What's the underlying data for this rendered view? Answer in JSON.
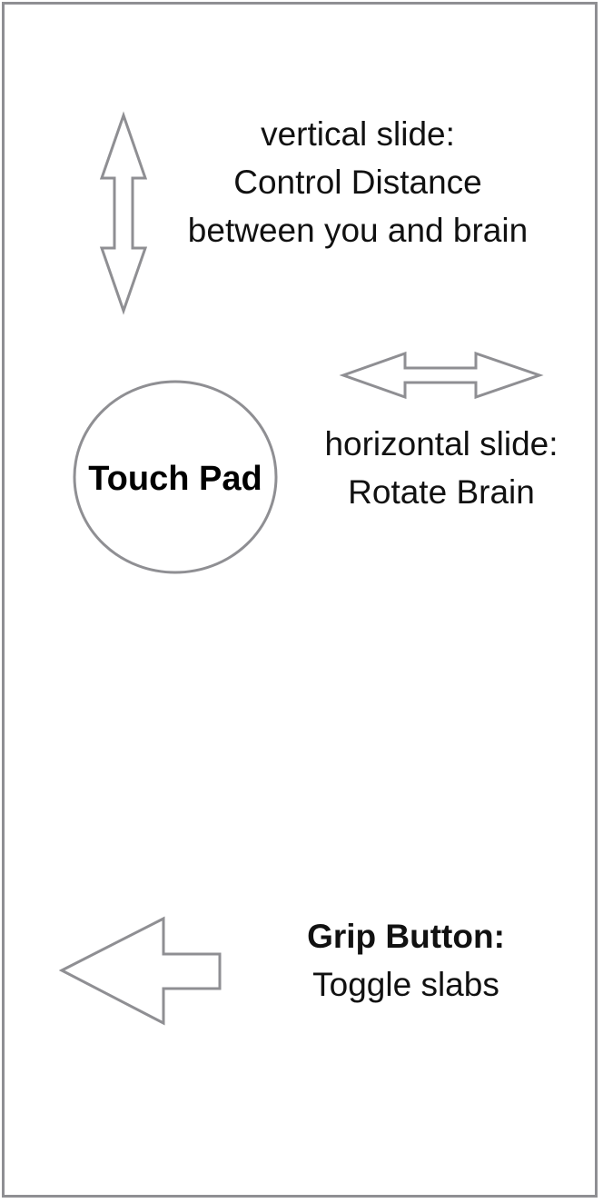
{
  "vertical_slide": {
    "line1": "vertical slide:",
    "line2": "Control Distance",
    "line3": "between you and brain",
    "icon": "vertical-double-arrow-icon"
  },
  "horizontal_slide": {
    "line1": "horizontal slide:",
    "line2": "Rotate Brain",
    "icon": "horizontal-double-arrow-icon"
  },
  "touch_pad": {
    "label": "Touch Pad",
    "icon": "circle-outline"
  },
  "grip_button": {
    "title": "Grip Button:",
    "description": "Toggle slabs",
    "icon": "left-arrow-icon"
  },
  "colors": {
    "outline": "#8f8f93",
    "text": "#111111",
    "background": "#ffffff"
  }
}
